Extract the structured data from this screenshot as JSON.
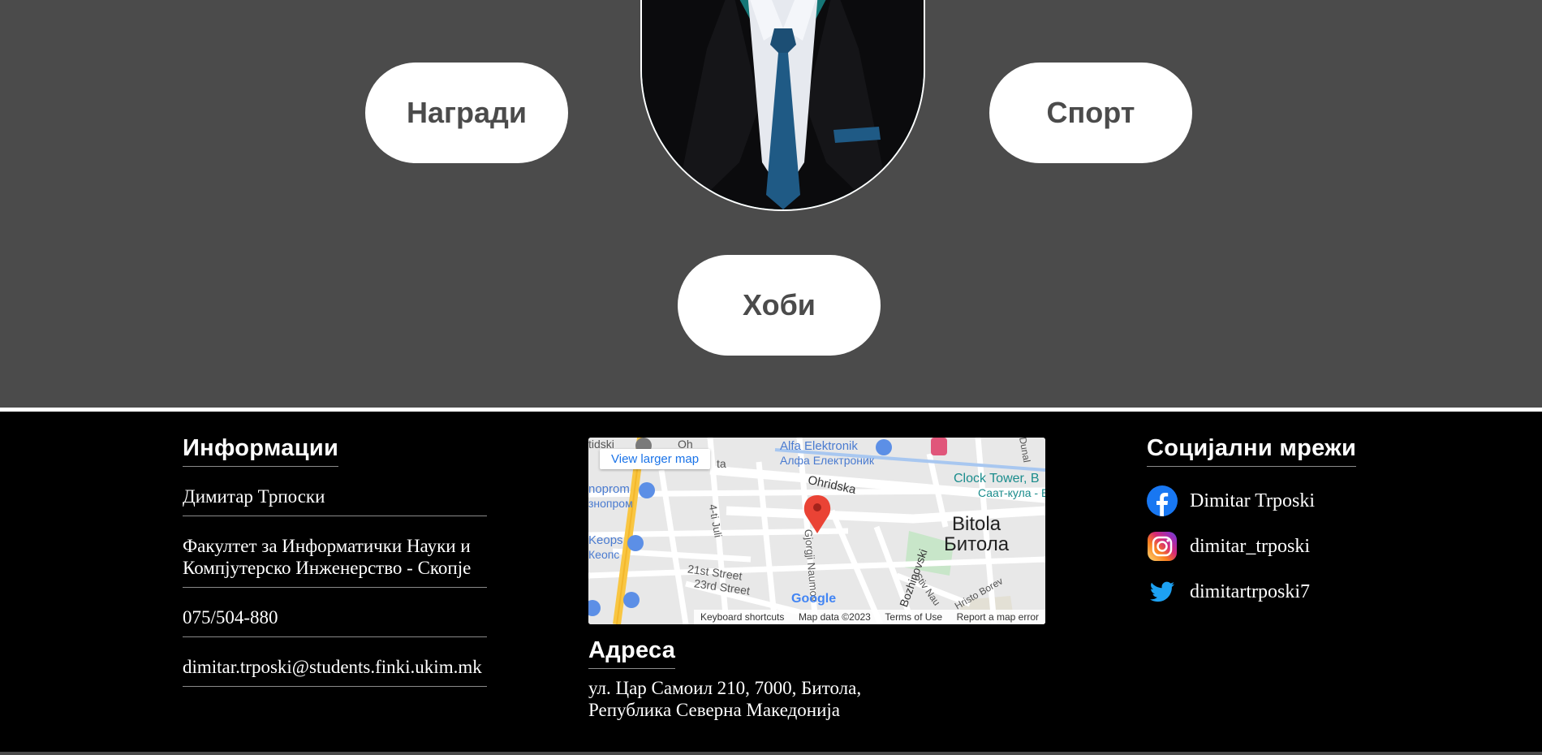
{
  "sections": {
    "awards_label": "Награди",
    "sport_label": "Спорт",
    "hobby_label": "Хоби"
  },
  "footer": {
    "info": {
      "heading": "Информации",
      "items": [
        "Димитар Трпоски",
        "Факултет за Информатички Науки и Компјутерско Инженерство - Скопје",
        "075/504-880",
        "dimitar.trposki@students.finki.ukim.mk"
      ]
    },
    "map": {
      "larger_map_link": "View larger map",
      "labels": {
        "alfa": "Alfa Elektronik",
        "alfa_mk": "Алфа Електроник",
        "clock": "Clock Tower, B",
        "clock_mk": "Саат-кула - Б",
        "ohridska": "Ohridska",
        "bitola": "Bitola",
        "bitola_mk": "Битола",
        "tidski": "tidski",
        "nprom": "noprom",
        "nprom_mk": "знопром",
        "keops": "Keops",
        "keops_mk": "Кеопс",
        "juli": "4-ti Juli",
        "st21": "21st Street",
        "st23": "23rd Street",
        "naumov": "Gjorgji Naumov",
        "bozhinovski": "Bozhinovski",
        "stiv": "Stiv Nau",
        "hristo": "Hristo Borev",
        "ohridska_short": "Oh",
        "dunal": "Dunal",
        "ta": "ta",
        "google": "Google"
      },
      "keyboard_shortcuts": "Keyboard shortcuts",
      "map_data": "Map data ©2023",
      "terms": "Terms of Use",
      "report": "Report a map error",
      "colors": {
        "pin": "#ea4335",
        "road_major": "#f9c642",
        "park": "#c8e6c9"
      }
    },
    "address": {
      "heading": "Адреса",
      "line1": "ул. Цар Самоил 210, 7000, Битола,",
      "line2": "Република Северна Македонија"
    },
    "social": {
      "heading": "Социјални мрежи",
      "items": [
        {
          "icon": "facebook-icon",
          "label": "Dimitar Trposki"
        },
        {
          "icon": "instagram-icon",
          "label": "dimitar_trposki"
        },
        {
          "icon": "twitter-icon",
          "label": "dimitartrposki7"
        }
      ]
    }
  },
  "colors": {
    "hero_bg": "#4b4b4b",
    "footer_bg": "#000000",
    "pill_bg": "#ffffff",
    "pill_text": "#4b4b4b"
  }
}
